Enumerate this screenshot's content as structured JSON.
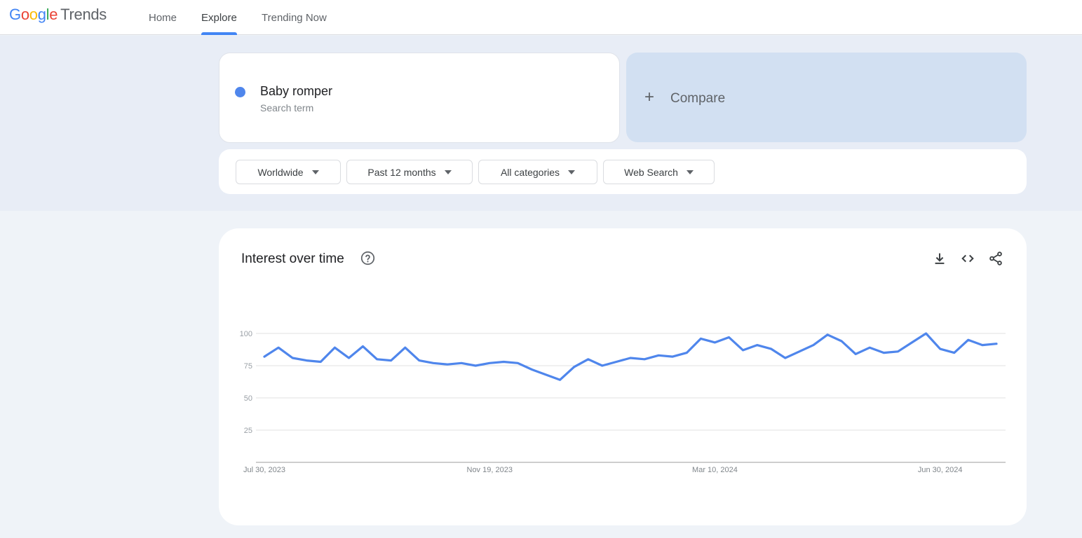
{
  "header": {
    "logo_google": [
      "G",
      "o",
      "o",
      "g",
      "l",
      "e"
    ],
    "logo_product": "Trends",
    "nav": [
      {
        "label": "Home",
        "active": false
      },
      {
        "label": "Explore",
        "active": true
      },
      {
        "label": "Trending Now",
        "active": false
      }
    ]
  },
  "search_terms": [
    {
      "name": "Baby romper",
      "type": "Search term",
      "color": "#4f86ec"
    }
  ],
  "compare": {
    "icon": "plus-icon",
    "label": "Compare"
  },
  "filters": [
    {
      "label": "Worldwide",
      "icon": "caret-down-icon"
    },
    {
      "label": "Past 12 months",
      "icon": "caret-down-icon"
    },
    {
      "label": "All categories",
      "icon": "caret-down-icon"
    },
    {
      "label": "Web Search",
      "icon": "caret-down-icon"
    }
  ],
  "interest_card": {
    "title": "Interest over time",
    "help_icon": "help-circle-icon",
    "actions": [
      "download-icon",
      "embed-code-icon",
      "share-icon"
    ]
  },
  "chart_data": {
    "type": "line",
    "title": "Interest over time",
    "xlabel": "",
    "ylabel": "",
    "ylim": [
      0,
      100
    ],
    "y_ticks": [
      25,
      50,
      75,
      100
    ],
    "x_tick_labels": [
      {
        "index": 0,
        "label": "Jul 30, 2023"
      },
      {
        "index": 16,
        "label": "Nov 19, 2023"
      },
      {
        "index": 32,
        "label": "Mar 10, 2024"
      },
      {
        "index": 48,
        "label": "Jun 30, 2024"
      }
    ],
    "x_start": "Jul 30, 2023",
    "x_interval": "weekly",
    "grid": true,
    "series": [
      {
        "name": "Baby romper",
        "color": "#4f86ec",
        "values": [
          82,
          89,
          81,
          79,
          78,
          89,
          81,
          90,
          80,
          79,
          89,
          79,
          77,
          76,
          77,
          75,
          77,
          78,
          77,
          72,
          68,
          64,
          74,
          80,
          75,
          78,
          81,
          80,
          83,
          82,
          85,
          96,
          93,
          97,
          87,
          91,
          88,
          81,
          86,
          91,
          99,
          94,
          84,
          89,
          85,
          86,
          93,
          100,
          88,
          85,
          95,
          91,
          92
        ]
      }
    ]
  }
}
